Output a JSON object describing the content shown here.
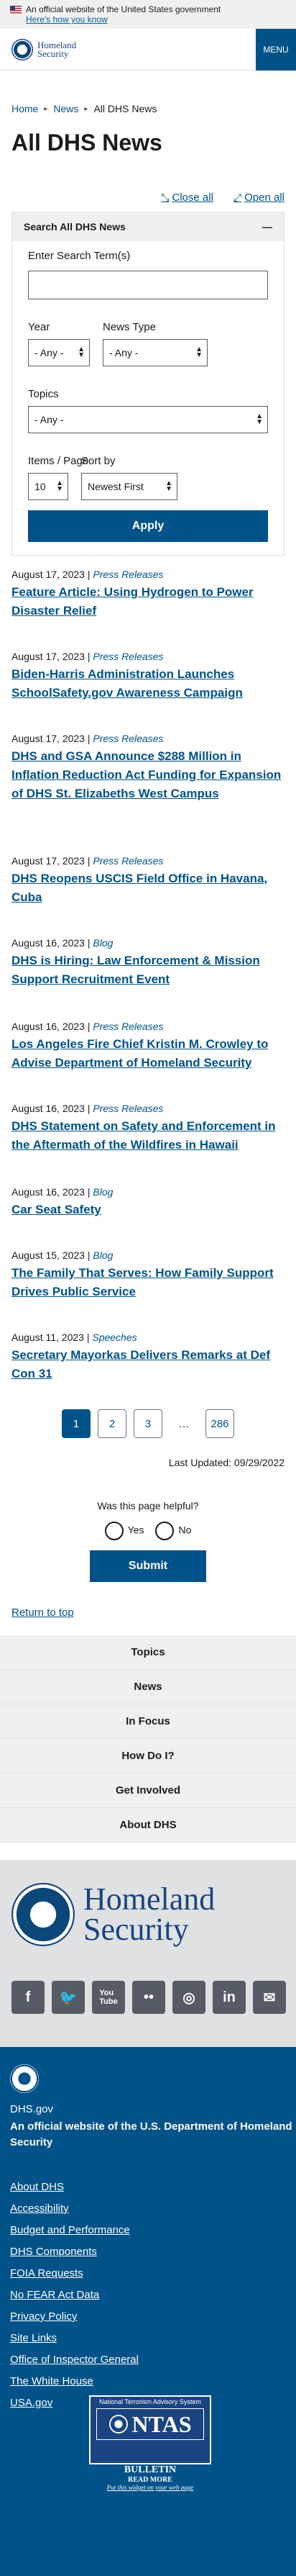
{
  "gov_banner": {
    "text": "An official website of the United States government",
    "link": "Here's how you know"
  },
  "header": {
    "logo_line1": "Homeland",
    "logo_line2": "Security",
    "menu_label": "MENU"
  },
  "breadcrumb": [
    "Home",
    "News",
    "All DHS News"
  ],
  "page_title": "All DHS News",
  "accordion": {
    "close_all": "Close all",
    "open_all": "Open all"
  },
  "search": {
    "title": "Search All DHS News",
    "term_label": "Enter Search Term(s)",
    "term_value": "",
    "year_label": "Year",
    "year_value": "- Any -",
    "type_label": "News Type",
    "type_value": "- Any -",
    "topics_label": "Topics",
    "topics_value": "- Any -",
    "items_label": "Items / Page",
    "items_value": "10",
    "sort_label": "Sort by",
    "sort_value": "Newest First",
    "apply": "Apply"
  },
  "news": [
    {
      "date": "August 17, 2023 |",
      "type": "Press Releases",
      "title": "Feature Article: Using Hydrogen to Power Disaster Relief"
    },
    {
      "date": "August 17, 2023 |",
      "type": "Press Releases",
      "title": "Biden-Harris Administration Launches SchoolSafety.gov Awareness Campaign"
    },
    {
      "date": "August 17, 2023 |",
      "type": "Press Releases",
      "title": "DHS and GSA Announce $288 Million in Inflation Reduction Act Funding for Expansion of DHS St. Elizabeths West Campus"
    },
    {
      "date": "August 17, 2023 |",
      "type": "Press Releases",
      "title": "DHS Reopens USCIS Field Office in Havana, Cuba"
    },
    {
      "date": "August 16, 2023 |",
      "type": "Blog",
      "title": "DHS is Hiring: Law Enforcement & Mission Support Recruitment Event"
    },
    {
      "date": "August 16, 2023 |",
      "type": "Press Releases",
      "title": "Los Angeles Fire Chief Kristin M. Crowley to Advise Department of Homeland Security"
    },
    {
      "date": "August 16, 2023 |",
      "type": "Press Releases",
      "title": "DHS Statement on Safety and Enforcement in the Aftermath of the Wildfires in Hawaii"
    },
    {
      "date": "August 16, 2023 |",
      "type": "Blog",
      "title": "Car Seat Safety"
    },
    {
      "date": "August 15, 2023 |",
      "type": "Blog",
      "title": "The Family That Serves: How Family Support Drives Public Service"
    },
    {
      "date": "August 11, 2023 |",
      "type": "Speeches",
      "title": "Secretary Mayorkas Delivers Remarks at Def Con 31"
    }
  ],
  "pager": [
    "1",
    "2",
    "3",
    "…",
    "286"
  ],
  "last_updated": "Last Updated: 09/29/2022",
  "feedback": {
    "question": "Was this page helpful?",
    "yes": "Yes",
    "no": "No",
    "submit": "Submit"
  },
  "return_top": "Return to top",
  "footer_nav": [
    "Topics",
    "News",
    "In Focus",
    "How Do I?",
    "Get Involved",
    "About DHS"
  ],
  "footer_brand": {
    "line1": "Homeland",
    "line2": "Security"
  },
  "socials": [
    "facebook-icon",
    "twitter-icon",
    "youtube-icon",
    "flickr-icon",
    "instagram-icon",
    "linkedin-icon",
    "email-icon"
  ],
  "footer": {
    "domain": "DHS.gov",
    "official_prefix": "An official website of the",
    "official_link": "U.S. Department of Homeland Security",
    "links": [
      "About DHS",
      "Accessibility",
      "Budget and Performance",
      "DHS Components",
      "FOIA Requests",
      "No FEAR Act Data",
      "Privacy Policy",
      "Site Links",
      "Office of Inspector General",
      "The White House",
      "USA.gov"
    ]
  },
  "ntas": {
    "top": "National Terrorism Advisory System",
    "name": "NTAS",
    "bulletin": "BULLETIN",
    "read_more": "READ MORE",
    "web_page": "Put this widget on your web page"
  }
}
